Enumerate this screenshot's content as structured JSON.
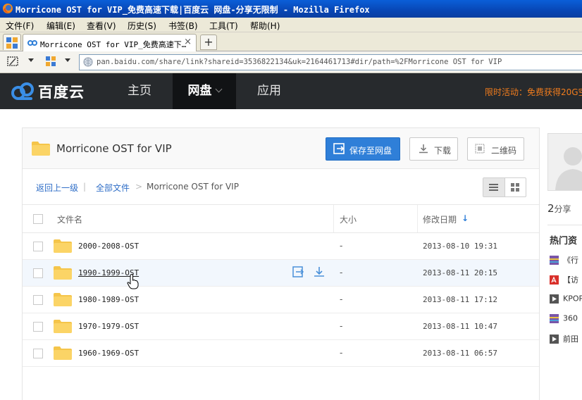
{
  "window": {
    "title": "Morricone OST for VIP_免费高速下载|百度云 网盘-分享无限制 - Mozilla Firefox"
  },
  "menu": [
    "文件(F)",
    "编辑(E)",
    "查看(V)",
    "历史(S)",
    "书签(B)",
    "工具(T)",
    "帮助(H)"
  ],
  "tabs": [
    {
      "label": "Morricone OST for VIP_免费高速下…",
      "close": "×"
    }
  ],
  "newtab_label": "+",
  "url": "pan.baidu.com/share/link?shareid=3536822134&uk=2164461713#dir/path=%2FMorricone OST for VIP",
  "site": {
    "logo_text": "百度云",
    "nav": [
      "主页",
      "网盘",
      "应用"
    ],
    "active_nav": "网盘",
    "promo": "限时活动：免费获得20G空"
  },
  "folder": {
    "title": "Morricone OST for VIP",
    "save_button": "保存至网盘",
    "download_button": "下载",
    "qr_button": "二维码"
  },
  "breadcrumb": {
    "back": "返回上一级",
    "sep1": "|",
    "all": "全部文件",
    "sep2": ">",
    "current": "Morricone OST for VIP"
  },
  "table": {
    "columns": [
      "文件名",
      "大小",
      "修改日期"
    ],
    "sort_arrow": "↓",
    "rows": [
      {
        "name": "2000-2008-OST",
        "size": "-",
        "date": "2013-08-10 19:31"
      },
      {
        "name": "1990-1999-OST",
        "size": "-",
        "date": "2013-08-11 20:15"
      },
      {
        "name": "1980-1989-OST",
        "size": "-",
        "date": "2013-08-11 17:12"
      },
      {
        "name": "1970-1979-OST",
        "size": "-",
        "date": "2013-08-11 10:47"
      },
      {
        "name": "1960-1969-OST",
        "size": "-",
        "date": "2013-08-11 06:57"
      }
    ]
  },
  "sidebar": {
    "share_count": "2",
    "share_unit": "分享",
    "hot_title": "热门资",
    "hot_items": [
      "《行",
      "【访",
      "KPOP",
      "360",
      "前田"
    ]
  },
  "colors": {
    "header_bg": "#272a2d",
    "accent_blue": "#2f7fd8",
    "promo_orange": "#f07c1d",
    "folder_yellow": "#f5c54a"
  }
}
